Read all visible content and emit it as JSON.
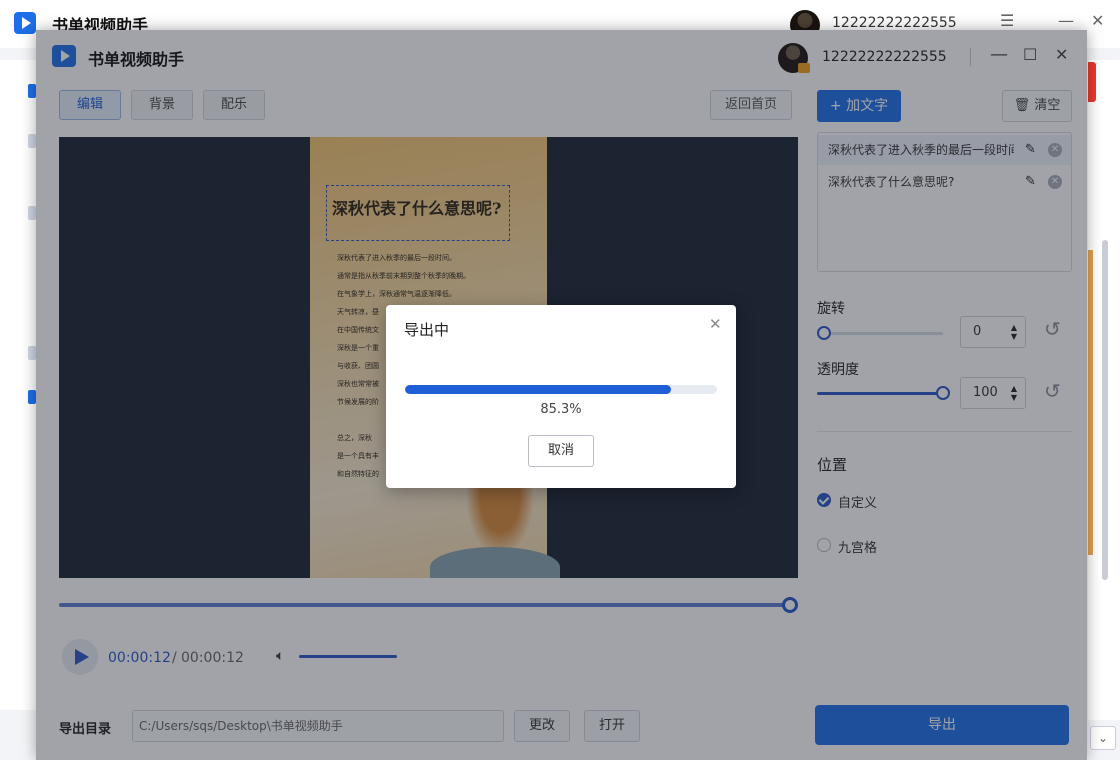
{
  "background_window": {
    "title": "书单视频助手",
    "username": "12222222222555",
    "controls": {
      "menu": "☰",
      "minimize": "—",
      "close": "✕"
    }
  },
  "window": {
    "title": "书单视频助手",
    "username": "12222222222555",
    "controls": {
      "minimize": "—",
      "maximize": "☐",
      "close": "✕"
    }
  },
  "editor_tabs": [
    {
      "label": "编辑",
      "active": true
    },
    {
      "label": "背景",
      "active": false
    },
    {
      "label": "配乐",
      "active": false
    }
  ],
  "back_home_label": "返回首页",
  "preview": {
    "title": "深秋代表了什么意思呢?",
    "lines": [
      "深秋代表了进入秋季的最后一段时间。",
      "通常是指从秋季前末期到整个秋季的晚期。",
      "在气象学上，深秋通常气温逐渐降低。",
      "天气转凉，昼",
      "在中国传统文",
      "深秋是一个重",
      "与收获、团圆",
      "深秋也常常被",
      "节候发展的阶",
      "",
      "总之，深秋",
      "是一个具有丰",
      "和自然特征的"
    ]
  },
  "player": {
    "current_time": "00:00:12",
    "separator": "/",
    "total_time": "00:00:12",
    "volume_icon": "speaker-icon",
    "progress": 1.0
  },
  "export": {
    "dir_label": "导出目录",
    "path": "C:/Users/sqs/Desktop\\书单视频助手",
    "change_label": "更改",
    "open_label": "打开",
    "export_label": "导出"
  },
  "right_panel": {
    "add_text_label": "+ 加文字",
    "clear_label": "清空",
    "text_items": [
      {
        "label": "深秋代表了进入秋季的最后一段时间",
        "selected": true
      },
      {
        "label": "深秋代表了什么意思呢?",
        "selected": false
      }
    ],
    "rotation": {
      "label": "旋转",
      "value": "0",
      "fraction": 0.0
    },
    "opacity": {
      "label": "透明度",
      "value": "100",
      "fraction": 1.0
    },
    "position": {
      "title": "位置",
      "options": [
        {
          "label": "自定义",
          "checked": true
        },
        {
          "label": "九宫格",
          "checked": false
        }
      ]
    }
  },
  "modal": {
    "title": "导出中",
    "progress_text": "85.3%",
    "progress_fraction": 0.853,
    "cancel_label": "取消"
  },
  "colors": {
    "accent": "#1e6ee8",
    "overlay": "rgba(30,36,48,0.42)"
  }
}
